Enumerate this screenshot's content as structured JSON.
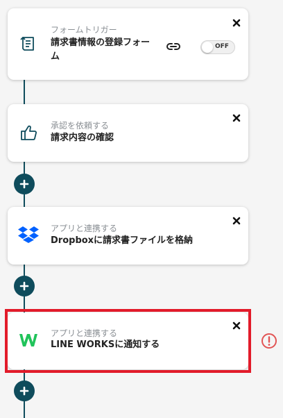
{
  "steps": [
    {
      "subtitle": "フォームトリガー",
      "title": "請求書情報の登録フォーム",
      "icon": "form-icon",
      "toggle_label": "OFF"
    },
    {
      "subtitle": "承認を依頼する",
      "title": "請求内容の確認",
      "icon": "thumbs-up-icon"
    },
    {
      "subtitle": "アプリと連携する",
      "title": "Dropboxに請求書ファイルを格納",
      "icon": "dropbox-icon"
    },
    {
      "subtitle": "アプリと連携する",
      "title": "LINE WORKSに通知する",
      "icon": "line-works-icon"
    }
  ],
  "colors": {
    "accent": "#0f4c5c",
    "highlight": "#e21b2a",
    "alert": "#e25454"
  }
}
